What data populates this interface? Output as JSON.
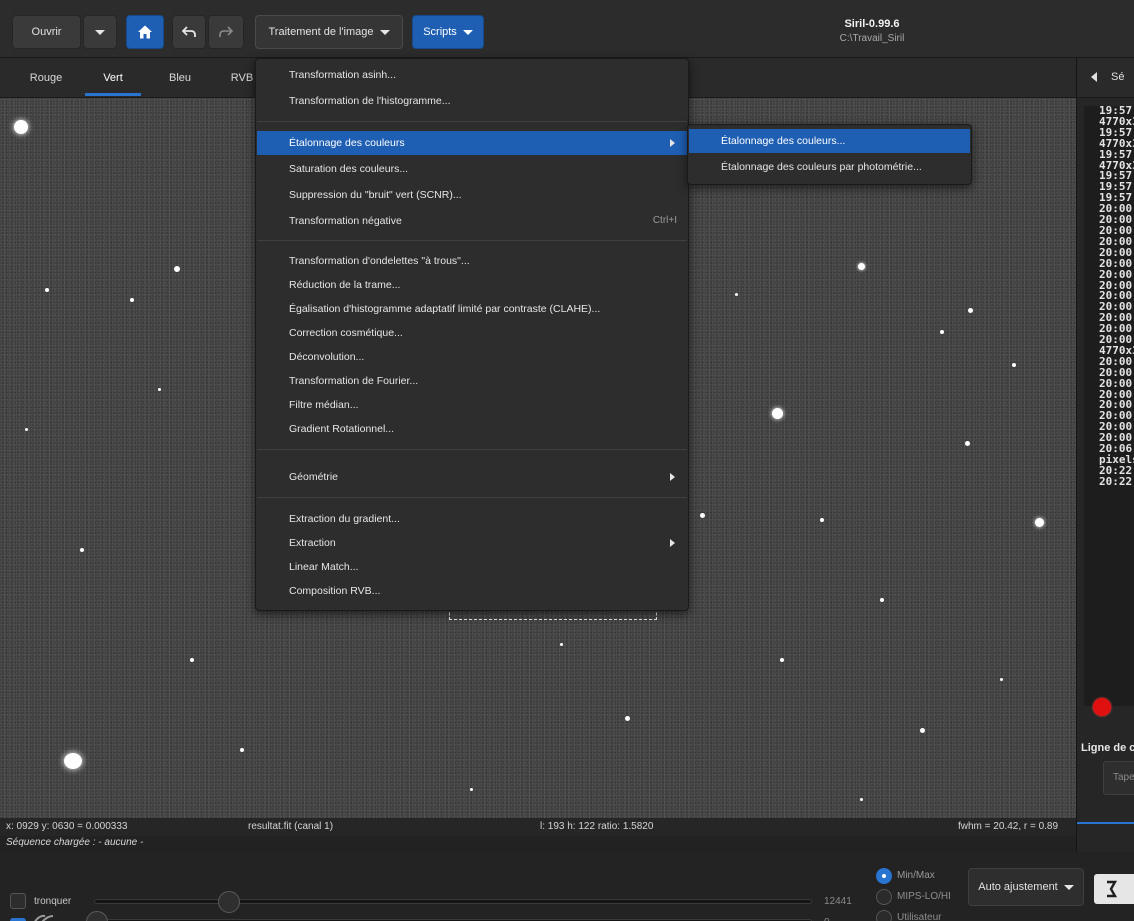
{
  "header": {
    "open_label": "Ouvrir",
    "image_processing_label": "Traitement de l'image",
    "scripts_label": "Scripts",
    "app_title": "Siril-0.99.6",
    "app_path": "C:\\Travail_Siril"
  },
  "tabs": [
    {
      "label": "Rouge"
    },
    {
      "label": "Vert"
    },
    {
      "label": "Bleu"
    },
    {
      "label": "RVB"
    }
  ],
  "menu": {
    "items": [
      {
        "label": "Transformation asinh..."
      },
      {
        "label": "Transformation de l'histogramme..."
      },
      {
        "label": "Étalonnage des couleurs"
      },
      {
        "label": "Saturation des couleurs..."
      },
      {
        "label": "Suppression du \"bruit\" vert (SCNR)..."
      },
      {
        "label": "Transformation négative",
        "accel": "Ctrl+I"
      },
      {
        "label": "Transformation d'ondelettes \"à trous\"..."
      },
      {
        "label": "Réduction de la trame..."
      },
      {
        "label": "Égalisation d'histogramme adaptatif limité par contraste (CLAHE)..."
      },
      {
        "label": "Correction cosmétique..."
      },
      {
        "label": "Déconvolution..."
      },
      {
        "label": "Transformation de Fourier..."
      },
      {
        "label": "Filtre médian..."
      },
      {
        "label": "Gradient Rotationnel..."
      },
      {
        "label": "Géométrie"
      },
      {
        "label": "Extraction du gradient..."
      },
      {
        "label": "Extraction"
      },
      {
        "label": "Linear Match..."
      },
      {
        "label": "Composition RVB..."
      }
    ]
  },
  "submenu": {
    "items": [
      {
        "label": "Étalonnage des couleurs..."
      },
      {
        "label": "Étalonnage des couleurs par photométrie..."
      }
    ]
  },
  "status": {
    "coords": "x: 0929 y: 0630 = 0.000333",
    "filename": "resultat.fit (canal 1)",
    "dimensions": "l: 193 h: 122 ratio: 1.5820",
    "fwhm": "fwhm = 20.42, r = 0.89",
    "sequence": "Séquence chargée : - aucune -"
  },
  "bottom": {
    "truncate_label": "tronquer",
    "max_value": "12441",
    "min_value": "0",
    "radio_minmax": "Min/Max",
    "radio_mips": "MIPS-LO/HI",
    "radio_user": "Utilisateur",
    "auto_adjust_label": "Auto ajustement"
  },
  "right_panel": {
    "header_label": "Sé",
    "log_lines": [
      "19:57:",
      "4770x3",
      "19:57:",
      "4770x3",
      "19:57:",
      "4770x3",
      "19:57:",
      "19:57:",
      "19:57:",
      "20:00:",
      "20:00:",
      "20:00:",
      "20:00:",
      "20:00:",
      "20:00:",
      "20:00:",
      "20:00:",
      "20:00:",
      "20:00:",
      "20:00:",
      "20:00:",
      "20:00:",
      "4770x3",
      "20:00:",
      "20:00:",
      "20:00:",
      "20:00:",
      "20:00:",
      "20:00:",
      "20:00:",
      "20:00:",
      "20:06:",
      "pixels",
      "20:22:",
      "20:22:"
    ],
    "cmd_label": "Ligne de c",
    "cmd_placeholder": "Taper"
  },
  "colors": {
    "accent": "#1e5fb3",
    "record": "#e01010"
  }
}
